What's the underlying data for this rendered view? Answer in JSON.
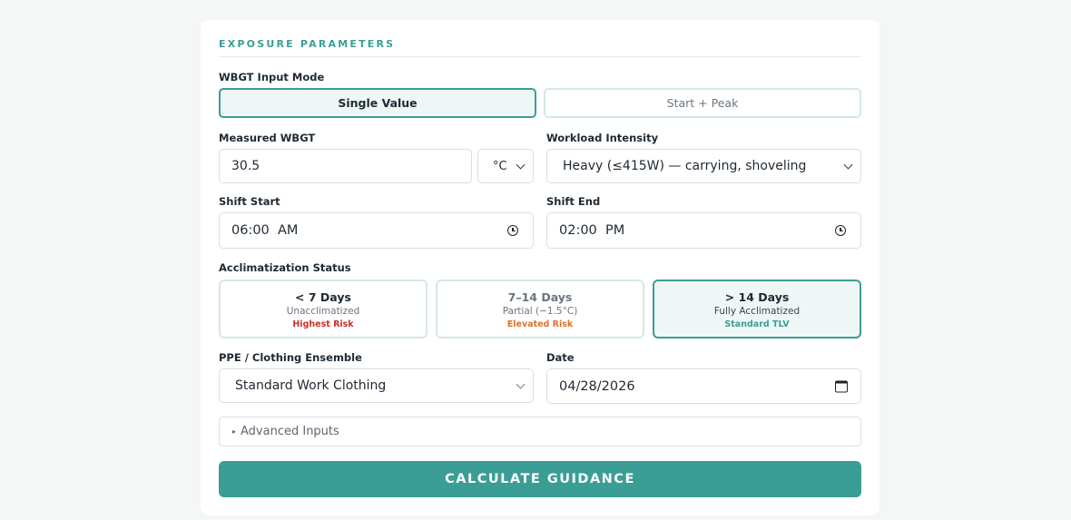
{
  "section": {
    "title": "EXPOSURE PARAMETERS"
  },
  "wbgt_mode": {
    "label": "WBGT Input Mode",
    "options": [
      "Single Value",
      "Start + Peak"
    ],
    "selected": "Single Value"
  },
  "measured_wbgt": {
    "label": "Measured WBGT",
    "value": "30.5",
    "unit": "°C"
  },
  "workload": {
    "label": "Workload Intensity",
    "value": "Heavy (≤415W) — carrying, shoveling"
  },
  "shift_start": {
    "label": "Shift Start",
    "value": "06:00  AM"
  },
  "shift_end": {
    "label": "Shift End",
    "value": "02:00  PM"
  },
  "acclimatization": {
    "label": "Acclimatization Status",
    "options": [
      {
        "title": "< 7 Days",
        "subtitle": "Unacclimatized",
        "risk": "Highest Risk",
        "risk_color": "#c9302c"
      },
      {
        "title": "7–14 Days",
        "subtitle": "Partial (−1.5°C)",
        "risk": "Elevated Risk",
        "risk_color": "#e0702a"
      },
      {
        "title": "> 14 Days",
        "subtitle": "Fully Acclimatized",
        "risk": "Standard TLV",
        "risk_color": "#3a9e96"
      }
    ],
    "selected": "> 14 Days"
  },
  "ppe": {
    "label": "PPE / Clothing Ensemble",
    "value": "Standard Work Clothing"
  },
  "date": {
    "label": "Date",
    "value": "04/28/2026"
  },
  "advanced": {
    "label": "Advanced Inputs"
  },
  "calculate": {
    "label": "CALCULATE GUIDANCE"
  },
  "colors": {
    "accent": "#3a9e96",
    "accent_bg": "#eef7f6"
  },
  "icons": [
    "chevron-down-icon",
    "clock-icon",
    "calendar-icon",
    "disclosure-triangle-icon"
  ]
}
